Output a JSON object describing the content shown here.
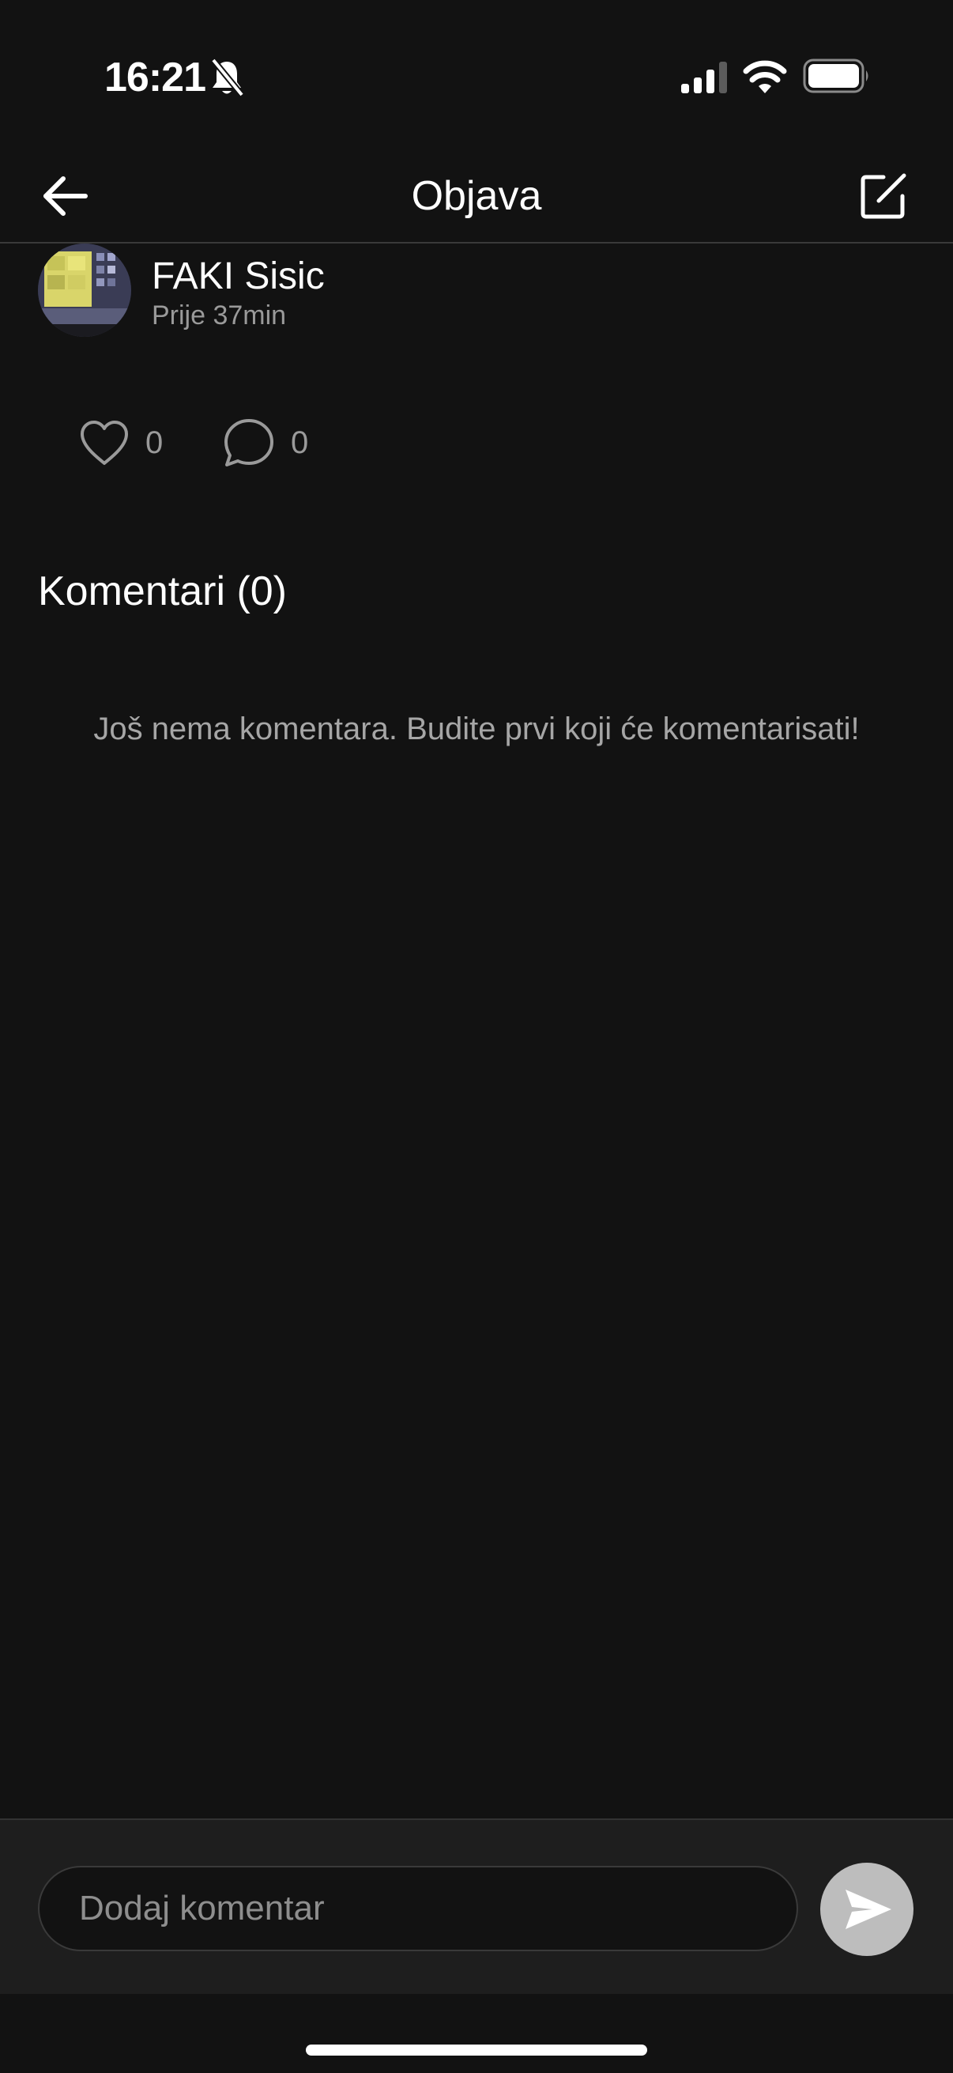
{
  "status_bar": {
    "time": "16:21",
    "icons": [
      "bell-slash-icon",
      "signal-icon",
      "wifi-icon",
      "battery-icon"
    ]
  },
  "header": {
    "title": "Objava",
    "back_icon": "arrow-left-icon",
    "edit_icon": "edit-square-icon"
  },
  "post": {
    "author": "FAKI Sisic",
    "time": "Prije 37min",
    "likes": "0",
    "comments": "0"
  },
  "comments_section": {
    "heading": "Komentari (0)",
    "empty_text": "Još nema komentara. Budite prvi koji će komentarisati!"
  },
  "input_bar": {
    "placeholder": "Dodaj komentar",
    "send_icon": "send-icon"
  },
  "colors": {
    "background": "#121212",
    "input_bar_background": "#1e1e1e",
    "muted_text": "#9a9a9a",
    "send_button": "#bdbdbd"
  }
}
